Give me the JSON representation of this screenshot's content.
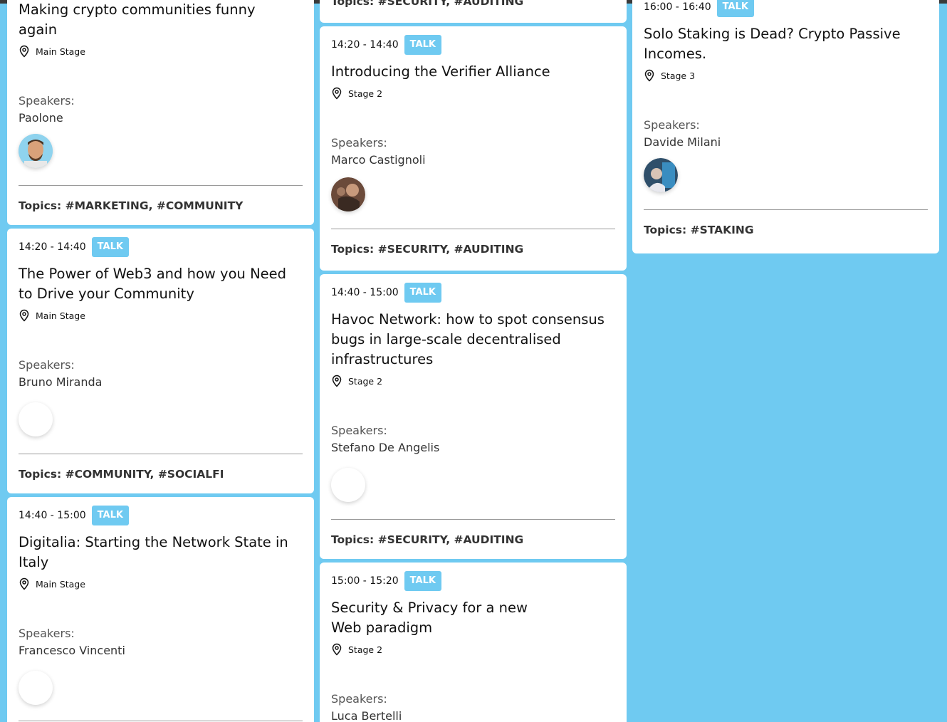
{
  "ui": {
    "speakers_label": "Speakers:",
    "topics_label": "Topics:"
  },
  "col1": {
    "card1": {
      "title": "Making crypto communities funny again",
      "location": "Main Stage",
      "speaker": "Paolone",
      "topics": "#MARKETING, #COMMUNITY"
    },
    "card2": {
      "time": "14:20 - 14:40",
      "badge": "TALK",
      "title": "The Power of Web3 and how you Need to Drive your Community",
      "location": "Main Stage",
      "speaker": "Bruno Miranda",
      "topics": "#COMMUNITY, #SOCIALFI"
    },
    "card3": {
      "time": "14:40 - 15:00",
      "badge": "TALK",
      "title": "Digitalia: Starting the Network State in Italy",
      "location": "Main Stage",
      "speaker": "Francesco Vincenti"
    }
  },
  "col2": {
    "card1": {
      "topics": "Topics: #SECURITY, #AUDITING"
    },
    "card2": {
      "time": "14:20 - 14:40",
      "badge": "TALK",
      "title": "Introducing the Verifier Alliance",
      "location": "Stage 2",
      "speaker": "Marco Castignoli",
      "topics": "#SECURITY, #AUDITING"
    },
    "card3": {
      "time": "14:40 - 15:00",
      "badge": "TALK",
      "title": "Havoc Network: how to spot consensus bugs in large-scale decentralised infrastructures",
      "location": "Stage 2",
      "speaker": "Stefano De Angelis",
      "topics": "#SECURITY, #AUDITING"
    },
    "card4": {
      "time": "15:00 - 15:20",
      "badge": "TALK",
      "title": "Security & Privacy for a new Web paradigm",
      "location": "Stage 2",
      "speaker": "Luca Bertelli"
    }
  },
  "col3": {
    "card1": {
      "time": "16:00 - 16:40",
      "badge": "TALK",
      "title": "Solo Staking is Dead? Crypto Passive Incomes.",
      "location": "Stage 3",
      "speaker": "Davide Milani",
      "topics": "#STAKING"
    }
  }
}
